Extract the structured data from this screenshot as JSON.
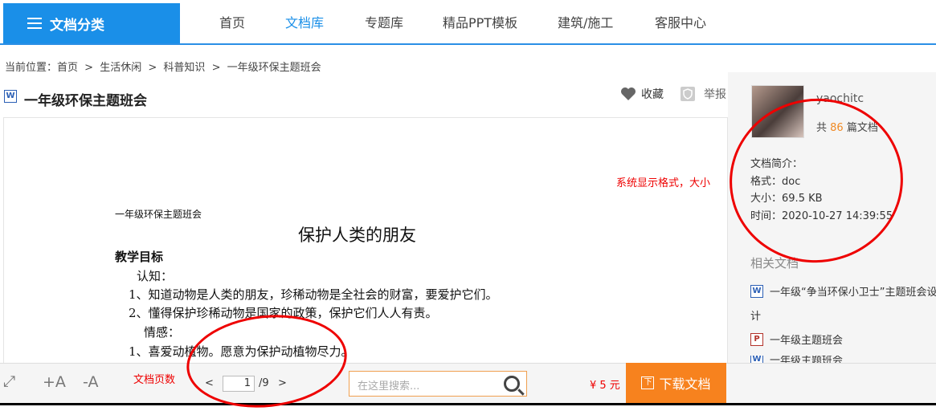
{
  "nav": {
    "category": "文档分类",
    "items": [
      "首页",
      "文档库",
      "专题库",
      "精品PPT模板",
      "建筑/施工",
      "客服中心"
    ]
  },
  "breadcrumb": [
    "当前位置：首页",
    ">",
    "生活休闲",
    ">",
    "科普知识",
    ">",
    "一年级环保主题班会"
  ],
  "doc": {
    "type_icon": "W",
    "title": "一年级环保主题班会",
    "favorite": "收藏",
    "report": "举报",
    "page_header": "一年级环保主题班会",
    "heading": "保护人类的朋友",
    "lines": [
      "教学目标",
      "认知：",
      "1、知道动物是人类的朋友，珍稀动物是全社会的财富，要爱护它们。",
      "2、懂得保护珍稀动物是国家的政策，保护它们人人有责。",
      "情感：",
      "1、喜爱动植物。愿意为保护动植物尽力。"
    ]
  },
  "author": {
    "name": "yaochitc",
    "count_prefix": "共",
    "count": "86",
    "count_suffix": "篇文档"
  },
  "summary": {
    "label": "文档简介：",
    "format_label": "格式：",
    "format": "doc",
    "size_label": "大小：",
    "size": "69.5 KB",
    "time_label": "时间：",
    "time": "2020-10-27 14:39:55"
  },
  "related": {
    "title": "相关文档",
    "items": [
      {
        "icon": "W",
        "label": "一年级“争当环保小卫士”主题班会设"
      },
      {
        "icon": "",
        "label": "计"
      },
      {
        "icon": "P",
        "label": "一年级主题班会"
      },
      {
        "icon": "W",
        "label": "一年级主题班会"
      }
    ]
  },
  "annotations": {
    "format_note": "系统显示格式，大小",
    "pages_note": "文档页数"
  },
  "toolbar": {
    "expand_icon": "⤢",
    "font_plus": "+A",
    "font_minus": "-A",
    "prev": "<",
    "page": "1",
    "total": "/9",
    "next": ">",
    "search_placeholder": "在这里搜索...",
    "price": "¥ 5 元",
    "download_icon": "下",
    "download": "下载文档"
  },
  "colors": {
    "brand_blue": "#1a8fe8",
    "download_orange": "#f7821e",
    "annotation_red": "#e00000"
  }
}
